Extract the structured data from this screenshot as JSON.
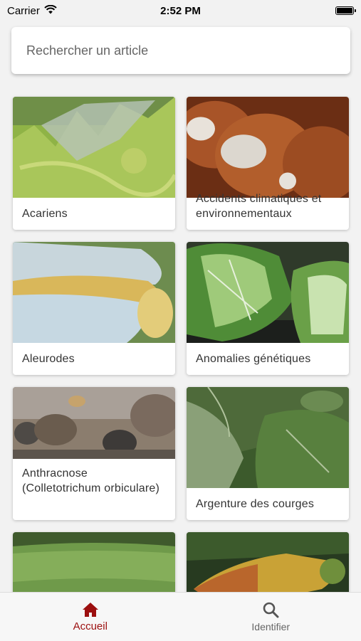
{
  "status_bar": {
    "carrier": "Carrier",
    "time": "2:52 PM"
  },
  "search": {
    "placeholder": "Rechercher un article"
  },
  "articles": [
    {
      "title": "Acariens"
    },
    {
      "title": "Accidents climatiques et environnementaux"
    },
    {
      "title": "Aleurodes"
    },
    {
      "title": "Anomalies génétiques"
    },
    {
      "title": "Anthracnose (Colletotrichum orbiculare)"
    },
    {
      "title": "Argenture des courges"
    },
    {
      "title": ""
    },
    {
      "title": ""
    }
  ],
  "tab_bar": {
    "tabs": [
      {
        "label": "Accueil",
        "icon": "home-icon",
        "active": true
      },
      {
        "label": "Identifier",
        "icon": "search-icon",
        "active": false
      }
    ]
  },
  "colors": {
    "accent": "#9c0f0f",
    "tab_inactive": "#666666"
  }
}
